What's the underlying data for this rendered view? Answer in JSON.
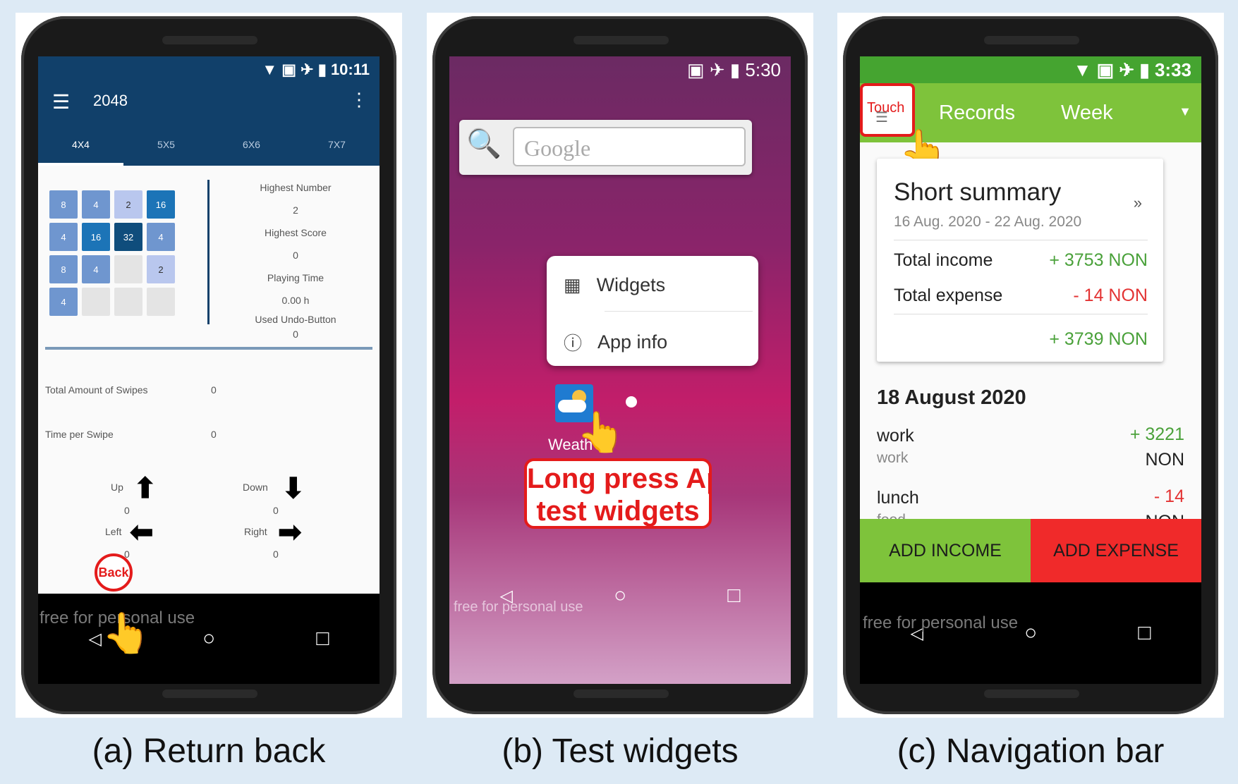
{
  "panels": {
    "a": {
      "caption": "(a) Return back",
      "status_time": "10:11",
      "app_title": "2048",
      "tabs": [
        "4X4",
        "5X5",
        "6X6",
        "7X7"
      ],
      "grid": [
        "8",
        "4",
        "2",
        "16",
        "4",
        "16",
        "32",
        "4",
        "8",
        "4",
        "",
        "2",
        "4",
        "",
        "",
        ""
      ],
      "stats": {
        "highest_number_label": "Highest Number",
        "highest_number": "2",
        "highest_score_label": "Highest Score",
        "highest_score": "0",
        "playing_time_label": "Playing Time",
        "playing_time": "0.00 h",
        "undo_label": "Used Undo-Button",
        "undo": "0"
      },
      "swipes_label": "Total Amount of Swipes",
      "swipes": "0",
      "time_per_swipe_label": "Time per Swipe",
      "time_per_swipe": "0",
      "dirs": {
        "up": "Up",
        "up_v": "0",
        "down": "Down",
        "down_v": "0",
        "left": "Left",
        "left_v": "0",
        "right": "Right",
        "right_v": "0"
      },
      "back_label": "Back",
      "watermark": "free for personal use"
    },
    "b": {
      "caption": "(b) Test widgets",
      "status_time": "5:30",
      "search_placeholder": "Google",
      "menu": [
        "Widgets",
        "App info"
      ],
      "app_label": "Weath",
      "callout_line1": "Long press App",
      "callout_line2": "test widgets",
      "watermark": "free for personal use"
    },
    "c": {
      "caption": "(c) Navigation bar",
      "status_time": "3:33",
      "touch_label": "Touch",
      "toolbar_title": "Records",
      "period": "Week",
      "summary_title": "Short summary",
      "summary_range": "16 Aug. 2020 - 22 Aug. 2020",
      "income_label": "Total income",
      "income": "+ 3753 NON",
      "expense_label": "Total expense",
      "expense": "- 14 NON",
      "balance": "+ 3739 NON",
      "date_header": "18 August 2020",
      "entries": [
        {
          "title": "work",
          "category": "work",
          "amount": "+ 3221",
          "currency": "NON"
        },
        {
          "title": "lunch",
          "category": "food",
          "amount": "- 14",
          "currency": "NON"
        }
      ],
      "add_income": "ADD INCOME",
      "add_expense": "ADD EXPENSE",
      "watermark": "free for personal use"
    }
  },
  "colors": {
    "tile_light": "#b9c7ee",
    "tile_mid": "#6f96cf",
    "tile_dark": "#1c74b7",
    "tile_empty": "#e4e4e4",
    "green": "#7ec33b",
    "red": "#f02a2a"
  }
}
